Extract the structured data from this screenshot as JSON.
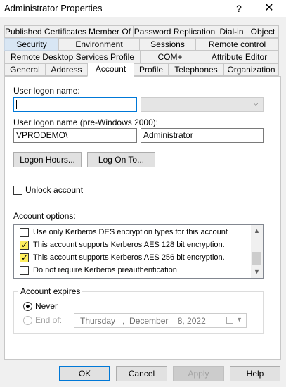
{
  "window": {
    "title": "Administrator Properties",
    "help_glyph": "?",
    "close_glyph": "✕"
  },
  "tabs": {
    "row1": [
      "Published Certificates",
      "Member Of",
      "Password Replication",
      "Dial-in",
      "Object"
    ],
    "row2": [
      "Security",
      "Environment",
      "Sessions",
      "Remote control"
    ],
    "row3": [
      "Remote Desktop Services Profile",
      "COM+",
      "Attribute Editor"
    ],
    "row4": [
      "General",
      "Address",
      "Account",
      "Profile",
      "Telephones",
      "Organization"
    ],
    "active": "Account"
  },
  "account": {
    "logon_name_label": "User logon name:",
    "logon_name_value": "",
    "domain_suffix_value": "",
    "pre2000_label": "User logon name (pre-Windows 2000):",
    "pre2000_domain": "VPRODEMO\\",
    "pre2000_user": "Administrator",
    "logon_hours_button": "Logon Hours...",
    "logon_to_button": "Log On To...",
    "unlock_label": "Unlock account",
    "unlock_checked": false,
    "options_label": "Account options:",
    "options": [
      {
        "label": "Use only Kerberos DES encryption types for this account",
        "checked": false
      },
      {
        "label": "This account supports Kerberos AES 128 bit encryption.",
        "checked": true
      },
      {
        "label": "This account supports Kerberos AES 256 bit encryption.",
        "checked": true
      },
      {
        "label": "Do not require Kerberos preauthentication",
        "checked": false
      }
    ],
    "expires_label": "Account expires",
    "never_label": "Never",
    "end_of_label": "End of:",
    "end_of_date": "Thursday   ,  December    8, 2022",
    "expires_selected": "Never"
  },
  "buttons": {
    "ok": "OK",
    "cancel": "Cancel",
    "apply": "Apply",
    "help": "Help"
  },
  "colors": {
    "accent": "#0078d7",
    "checked_highlight": "#ffef5f",
    "security_tab": "#d8e6f4"
  }
}
